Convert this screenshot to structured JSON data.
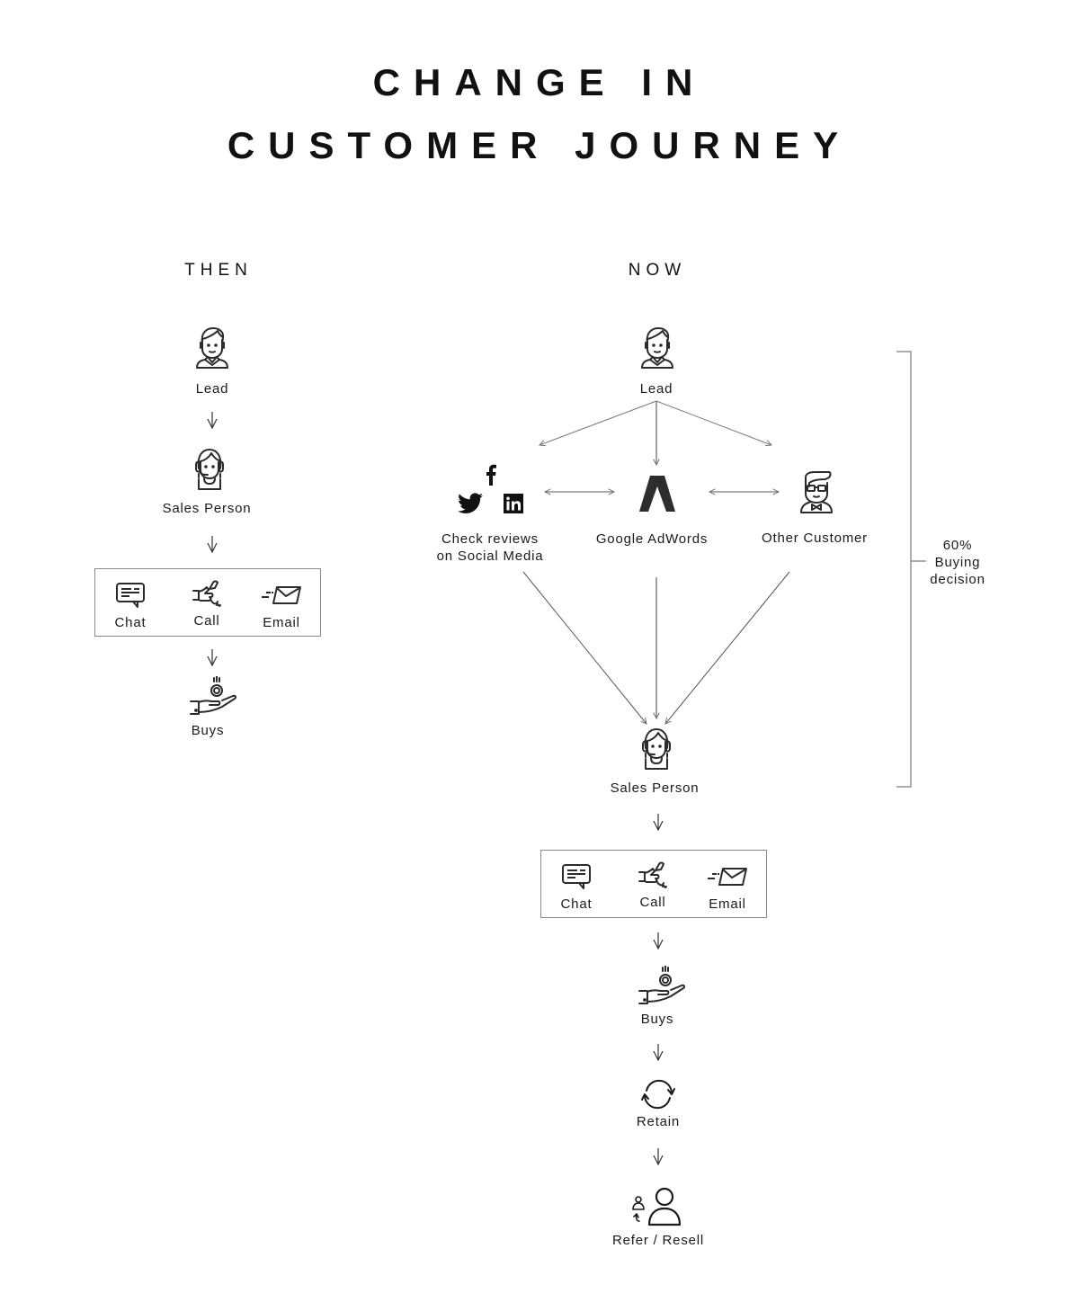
{
  "title": {
    "line1": "CHANGE IN",
    "line2": "CUSTOMER JOURNEY"
  },
  "then": {
    "heading": "THEN",
    "steps": {
      "lead": {
        "label": "Lead",
        "icon": "lead-person-icon"
      },
      "sales_person": {
        "label": "Sales Person",
        "icon": "sales-person-headset-icon"
      },
      "contact": {
        "chat": {
          "label": "Chat",
          "icon": "chat-bubble-icon"
        },
        "call": {
          "label": "Call",
          "icon": "phone-hand-icon"
        },
        "email": {
          "label": "Email",
          "icon": "email-envelope-icon"
        }
      },
      "buys": {
        "label": "Buys",
        "icon": "hand-coin-icon"
      }
    }
  },
  "now": {
    "heading": "NOW",
    "steps": {
      "lead": {
        "label": "Lead",
        "icon": "lead-person-icon"
      },
      "social": {
        "label_line1": "Check reviews",
        "label_line2": "on Social Media",
        "icons": [
          "twitter-icon",
          "facebook-icon",
          "linkedin-icon"
        ]
      },
      "adwords": {
        "label": "Google AdWords",
        "icon": "google-adwords-icon"
      },
      "other_customer": {
        "label": "Other Customer",
        "icon": "customer-glasses-icon"
      },
      "sales_person": {
        "label": "Sales Person",
        "icon": "sales-person-headset-icon"
      },
      "contact": {
        "chat": {
          "label": "Chat",
          "icon": "chat-bubble-icon"
        },
        "call": {
          "label": "Call",
          "icon": "phone-hand-icon"
        },
        "email": {
          "label": "Email",
          "icon": "email-envelope-icon"
        }
      },
      "buys": {
        "label": "Buys",
        "icon": "hand-coin-icon"
      },
      "retain": {
        "label": "Retain",
        "icon": "cycle-arrows-icon"
      },
      "refer": {
        "label": "Refer / Resell",
        "icon": "refer-people-icon"
      }
    },
    "bracket": {
      "percent": "60%",
      "line2": "Buying",
      "line3": "decision"
    }
  },
  "colors": {
    "text": "#111111",
    "line": "#7a7a7a",
    "icon": "#2b2b2b"
  }
}
